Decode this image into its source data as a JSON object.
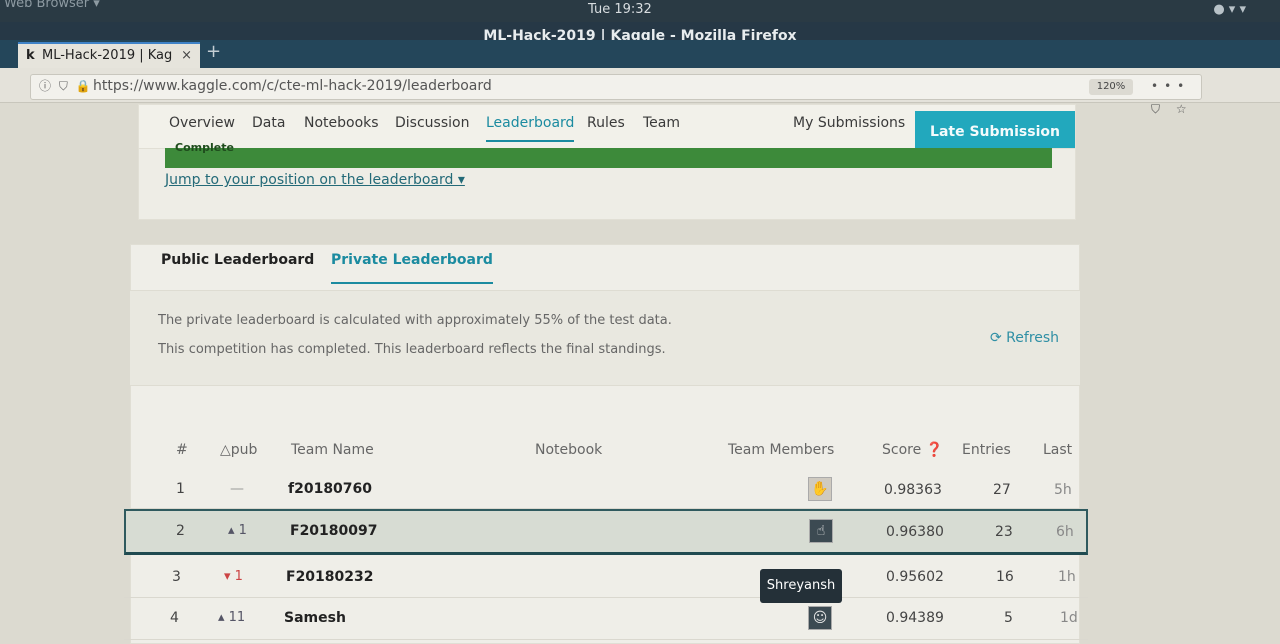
{
  "system": {
    "app_menu": "Web Browser ▾",
    "clock": "Tue 19:32",
    "tray": "● ▾  ▾"
  },
  "browser": {
    "window_title": "ML-Hack-2019 | Kaggle - Mozilla Firefox",
    "tab_favicon": "k",
    "tab_title": "ML-Hack-2019 | Kag",
    "tab_close": "×",
    "new_tab": "+",
    "url": "https://www.kaggle.com/c/cte-ml-hack-2019/leaderboard",
    "url_icons": "ⓘ ⛉ 🔒",
    "zoom": "120%",
    "toolbar_icons": "••• ⛉ ☆"
  },
  "nav": {
    "items": [
      "Overview",
      "Data",
      "Notebooks",
      "Discussion",
      "Leaderboard",
      "Rules",
      "Team"
    ],
    "active": "Leaderboard",
    "my_submissions": "My Submissions",
    "late_submission": "Late Submission"
  },
  "banner": {
    "status": "Complete",
    "jump_link": "Jump to your position on the leaderboard ▾"
  },
  "leaderboard": {
    "tabs": [
      "Public Leaderboard",
      "Private Leaderboard"
    ],
    "active_tab": "Private Leaderboard",
    "info_line1": "The private leaderboard is calculated with approximately 55% of the test data.",
    "info_line2": "This competition has completed. This leaderboard reflects the final standings.",
    "refresh": "⟳ Refresh",
    "columns": [
      "#",
      "△pub",
      "Team Name",
      "Notebook",
      "Team Members",
      "Score ❓",
      "Entries",
      "Last"
    ],
    "rows": [
      {
        "rank": "1",
        "change": "—",
        "team": "f20180760",
        "score": "0.98363",
        "entries": "27",
        "last": "5h"
      },
      {
        "rank": "2",
        "change": "▴ 1",
        "team": "F20180097",
        "score": "0.96380",
        "entries": "23",
        "last": "6h"
      },
      {
        "rank": "3",
        "change": "▾ 1",
        "team": "F20180232",
        "score": "0.95602",
        "entries": "16",
        "last": "1h"
      },
      {
        "rank": "4",
        "change": "▴ 11",
        "team": "Samesh",
        "score": "0.94389",
        "entries": "5",
        "last": "1d"
      }
    ],
    "tooltip": "Shreyansh"
  },
  "colors": {
    "accent": "#1b8ba0",
    "late_button": "#22a8bd",
    "banner_green": "#3d8a3a"
  }
}
